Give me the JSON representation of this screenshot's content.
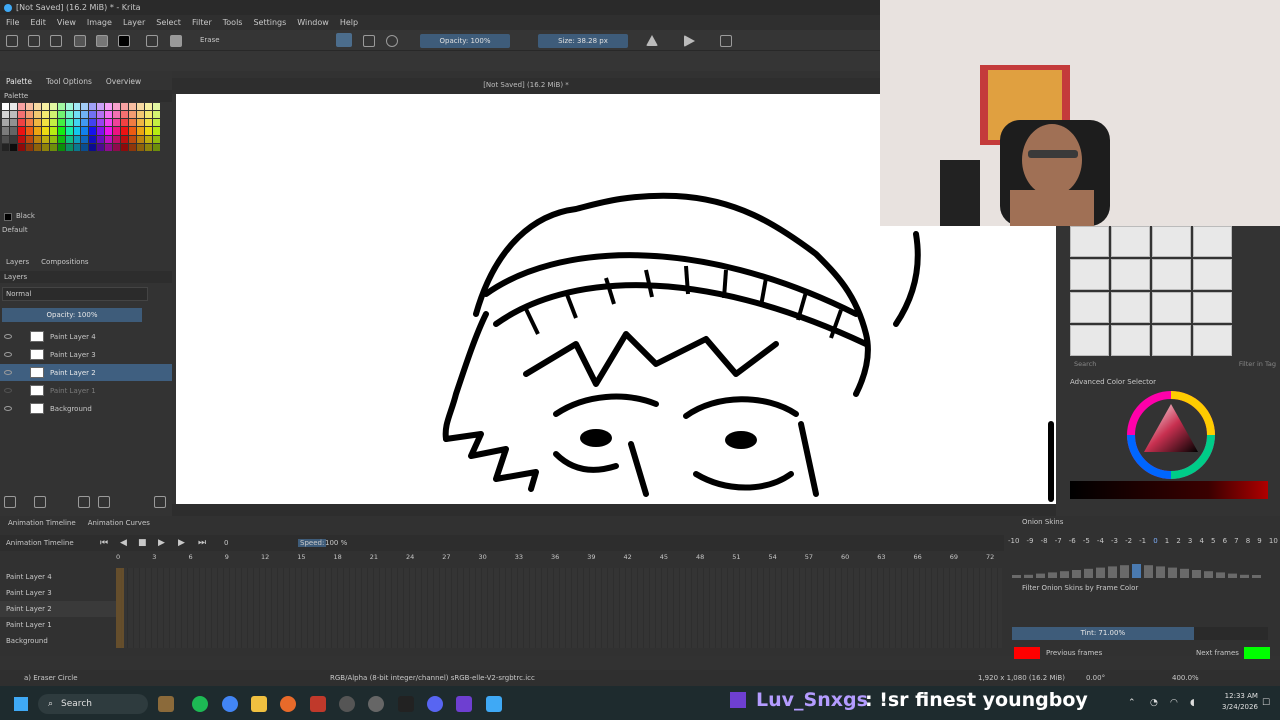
{
  "window": {
    "title": "[Not Saved]  (16.2 MiB) * - Krita"
  },
  "menu": [
    "File",
    "Edit",
    "View",
    "Image",
    "Layer",
    "Select",
    "Filter",
    "Tools",
    "Settings",
    "Window",
    "Help"
  ],
  "toolbar": {
    "preset_name": "Erase",
    "opacity_label": "Opacity: 100%",
    "size_label": "Size: 38.28 px"
  },
  "left_dock": {
    "tabs": [
      "Palette",
      "Tool Options",
      "Overview"
    ],
    "palette_title": "Palette",
    "current_color_name": "Black",
    "palette_set": "Default",
    "layers_tabs": [
      "Layers",
      "Compositions"
    ],
    "layers_title": "Layers",
    "blend_mode": "Normal",
    "opacity": "Opacity:  100%",
    "layers": [
      {
        "name": "Paint Layer 4",
        "state": "normal"
      },
      {
        "name": "Paint Layer 3",
        "state": "normal"
      },
      {
        "name": "Paint Layer 2",
        "state": "selected"
      },
      {
        "name": "Paint Layer 1",
        "state": "hidden"
      },
      {
        "name": "Background",
        "state": "locked"
      }
    ]
  },
  "canvas": {
    "tab_title": "[Not Saved]  (16.2 MiB) *"
  },
  "right_dock": {
    "search_placeholder": "Search",
    "filter_in_tag": "Filter in Tag",
    "color_selector_title": "Advanced Color Selector"
  },
  "timeline": {
    "tabs": [
      "Animation Timeline",
      "Animation Curves"
    ],
    "title": "Animation Timeline",
    "frame": "0",
    "speed_label": "Speed:",
    "speed_value": "100 %",
    "ruler": [
      "0",
      "3",
      "6",
      "9",
      "12",
      "15",
      "18",
      "21",
      "24",
      "27",
      "30",
      "33",
      "36",
      "39",
      "42",
      "45",
      "48",
      "51",
      "54",
      "57",
      "60",
      "63",
      "66",
      "69",
      "72"
    ],
    "layers": [
      "Paint Layer 4",
      "Paint Layer 3",
      "Paint Layer 2",
      "Paint Layer 1",
      "Background"
    ]
  },
  "onion": {
    "title": "Onion Skins",
    "numbers": [
      "-10",
      "-9",
      "-8",
      "-7",
      "-6",
      "-5",
      "-4",
      "-3",
      "-2",
      "-1",
      "0",
      "1",
      "2",
      "3",
      "4",
      "5",
      "6",
      "7",
      "8",
      "9",
      "10"
    ],
    "filter_label": "Filter Onion Skins by Frame Color",
    "tint_label": "Tint: 71.00%",
    "tint_fraction": 0.71,
    "previous_label": "Previous frames",
    "next_label": "Next frames",
    "previous_color": "#ff0000",
    "next_color": "#00ff00"
  },
  "status": {
    "tool": "a) Eraser Circle",
    "color_profile": "RGB/Alpha (8-bit integer/channel)  sRGB-elle-V2-srgbtrc.icc",
    "dimensions": "1,920 x 1,080 (16.2 MiB)",
    "rotation": "0.00°",
    "zoom": "400.0%"
  },
  "taskbar": {
    "search_label": "Search",
    "time": "12:33 AM",
    "date": "3/24/2026"
  },
  "chat": {
    "user": "Luv_Snxgs",
    "message": ": !sr finest youngboy"
  }
}
